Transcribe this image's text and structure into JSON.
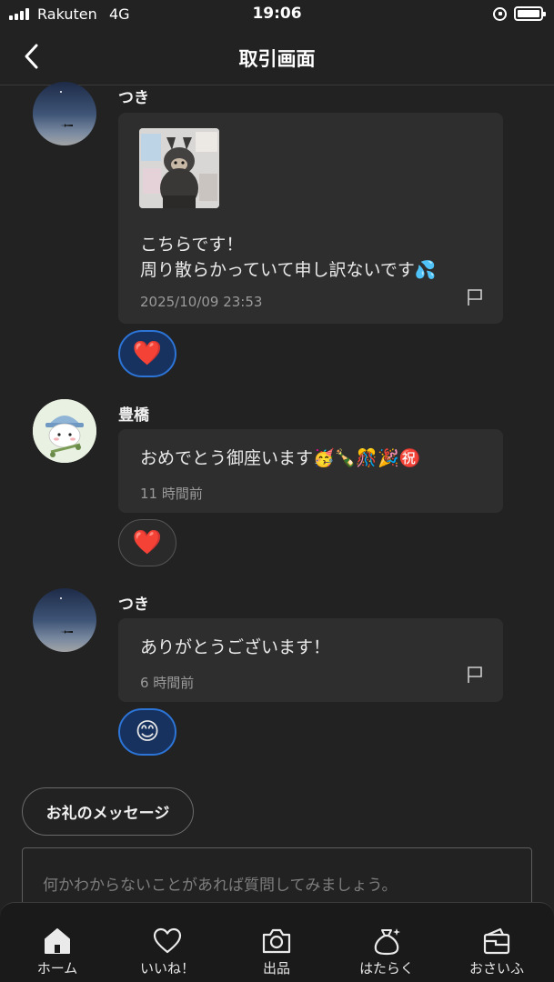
{
  "status_bar": {
    "carrier": "Rakuten",
    "network": "4G",
    "time": "19:06"
  },
  "header": {
    "title": "取引画面",
    "back_icon": "chevron-left-icon"
  },
  "messages": [
    {
      "sender": "つき",
      "avatar_icon": "night-sky-avatar",
      "image_icon": "photo-thumbnail",
      "text_lines": [
        "こちらです！",
        "周り散らかっていて申し訳ないです💦"
      ],
      "timestamp": "2025/10/09 23:53",
      "reaction": "❤️",
      "reaction_active": true
    },
    {
      "sender": "豊橋",
      "avatar_icon": "character-avatar",
      "text": "おめでとう御座います🥳🍾🎊🎉㊗️",
      "timestamp": "11 時間前",
      "reaction": "❤️",
      "reaction_active": false
    },
    {
      "sender": "つき",
      "avatar_icon": "night-sky-avatar",
      "text": "ありがとうございます！",
      "timestamp": "6 時間前",
      "reaction": "😊",
      "reaction_active": true
    }
  ],
  "thanks_button_label": "お礼のメッセージ",
  "input": {
    "placeholder": "何かわからないことがあれば質問してみましょう。"
  },
  "bottom_nav": [
    {
      "label": "ホーム",
      "icon": "home-icon",
      "active": true
    },
    {
      "label": "いいね！",
      "icon": "heart-icon"
    },
    {
      "label": "出品",
      "icon": "camera-icon"
    },
    {
      "label": "はたらく",
      "icon": "money-bag-icon"
    },
    {
      "label": "おさいふ",
      "icon": "wallet-icon"
    }
  ],
  "colors": {
    "background": "#222222",
    "bubble": "#2e2e2e",
    "reaction_active_border": "#2c74d6",
    "text": "#eaeaea",
    "muted": "#9a9a9a"
  }
}
